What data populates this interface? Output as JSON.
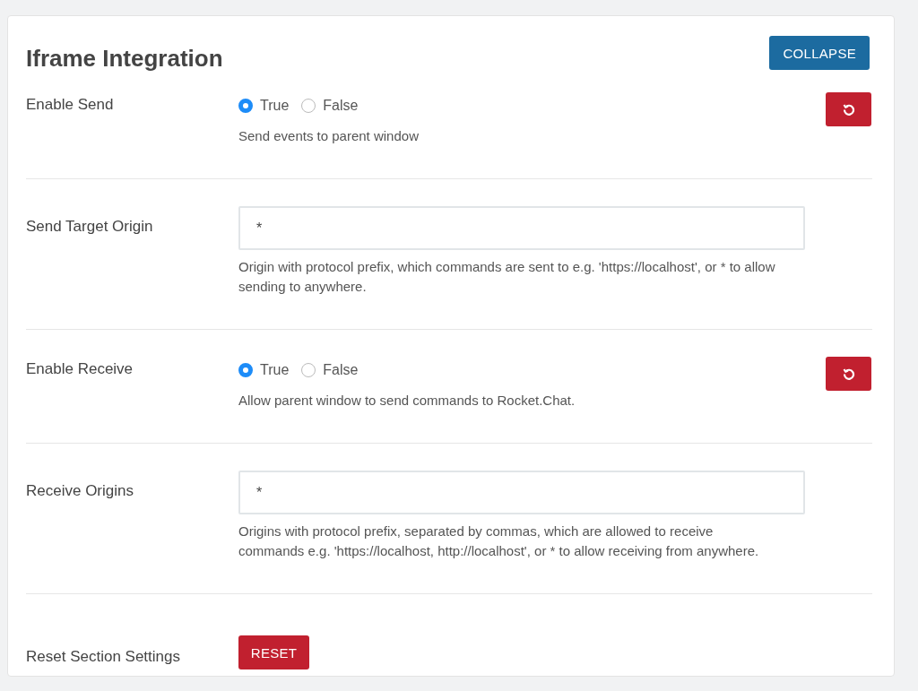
{
  "section": {
    "title": "Iframe Integration",
    "collapse_button": "COLLAPSE"
  },
  "settings": [
    {
      "kind": "radio",
      "label": "Enable Send",
      "options": [
        {
          "label": "True",
          "selected": true
        },
        {
          "label": "False",
          "selected": false
        }
      ],
      "description": "Send events to parent window",
      "changed": true
    },
    {
      "kind": "text",
      "label": "Send Target Origin",
      "value": "*",
      "description": "Origin with protocol prefix, which commands are sent to e.g. 'https://localhost', or * to allow sending to anywhere.",
      "changed": false
    },
    {
      "kind": "radio",
      "label": "Enable Receive",
      "options": [
        {
          "label": "True",
          "selected": true
        },
        {
          "label": "False",
          "selected": false
        }
      ],
      "description": "Allow parent window to send commands to Rocket.Chat.",
      "changed": true
    },
    {
      "kind": "text",
      "label": "Receive Origins",
      "value": "*",
      "description": "Origins with protocol prefix, separated by commas, which are allowed to receive commands e.g. 'https://localhost, http://localhost', or * to allow receiving from anywhere.",
      "changed": false
    },
    {
      "kind": "action",
      "label": "Reset Section Settings",
      "button": "RESET"
    }
  ]
}
